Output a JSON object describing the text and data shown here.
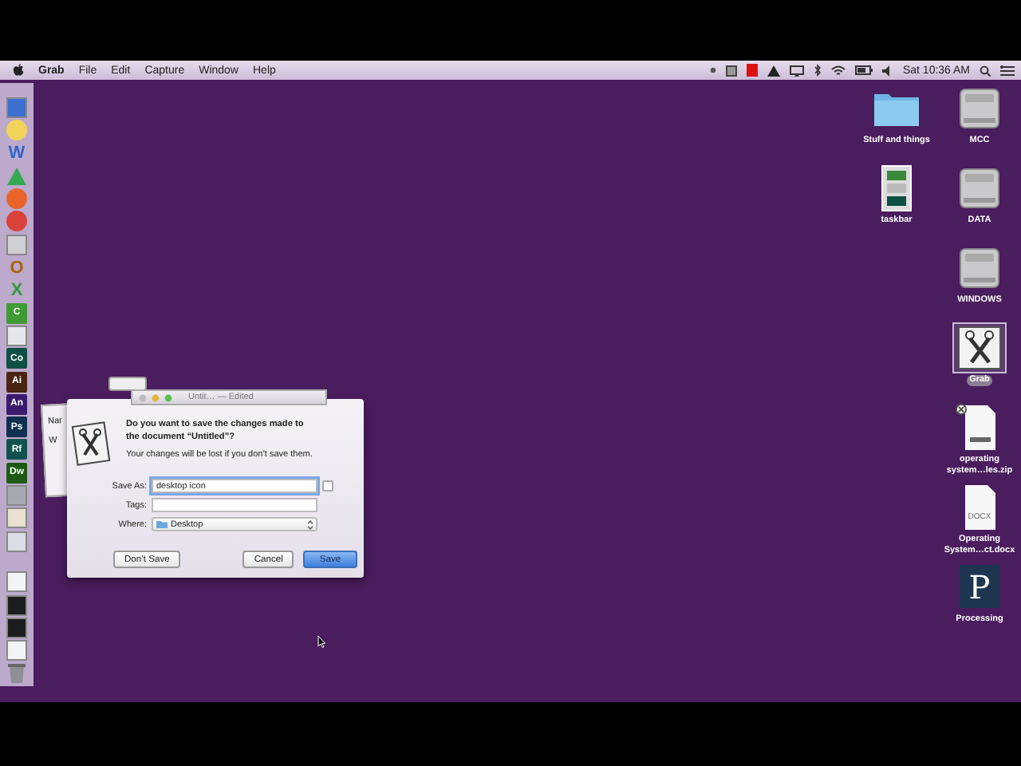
{
  "menubar": {
    "app": "Grab",
    "menus": [
      "File",
      "Edit",
      "Capture",
      "Window",
      "Help"
    ],
    "clock": "Sat 10:36 AM"
  },
  "dock": {
    "items": [
      {
        "kind": "tile",
        "color": "#3b6fd0"
      },
      {
        "kind": "round",
        "color": "#f2d35a"
      },
      {
        "kind": "letter",
        "label": "W",
        "color": "#2c66c9"
      },
      {
        "kind": "triangle",
        "color": "#36a852"
      },
      {
        "kind": "round",
        "color": "#e8642a"
      },
      {
        "kind": "round",
        "color": "#d9413a"
      },
      {
        "kind": "tile",
        "color": "#cfcfd4"
      },
      {
        "kind": "letter",
        "label": "O",
        "color": "#a8620a"
      },
      {
        "kind": "letter",
        "label": "X",
        "color": "#2f9a3a"
      },
      {
        "kind": "box",
        "label": "C",
        "color": "#3f9b34"
      },
      {
        "kind": "tile",
        "color": "#e6e6ea"
      },
      {
        "kind": "box",
        "label": "Co",
        "color": "#0e4f44"
      },
      {
        "kind": "box",
        "label": "Ai",
        "color": "#4a2511"
      },
      {
        "kind": "box",
        "label": "An",
        "color": "#3a1a6e"
      },
      {
        "kind": "box",
        "label": "Ps",
        "color": "#0f3050"
      },
      {
        "kind": "box",
        "label": "Rf",
        "color": "#10524d"
      },
      {
        "kind": "box",
        "label": "Dw",
        "color": "#1d5a12"
      },
      {
        "kind": "tile",
        "color": "#a8a8b0"
      },
      {
        "kind": "tile",
        "color": "#e9e2d0"
      },
      {
        "kind": "tile",
        "color": "#dcdce4"
      },
      {
        "kind": "gap"
      },
      {
        "kind": "tile",
        "color": "#f4f4f6"
      },
      {
        "kind": "tile",
        "color": "#1c1c1c"
      },
      {
        "kind": "tile",
        "color": "#1c1c1c"
      },
      {
        "kind": "tile",
        "color": "#f4f4f6"
      },
      {
        "kind": "trash",
        "color": "#8e8e96"
      }
    ]
  },
  "background_window": {
    "title": "Untit… — Edited",
    "texts": [
      "Nar",
      "W"
    ]
  },
  "save_sheet": {
    "heading": "Do you want to save the changes made to the document “Untitled”?",
    "message": "Your changes will be lost if you don’t save them.",
    "save_as": {
      "label": "Save As:",
      "value": "desktop icon"
    },
    "tags": {
      "label": "Tags:"
    },
    "where": {
      "label": "Where:",
      "value": "Desktop"
    },
    "buttons": [
      {
        "label": "Don’t Save",
        "default": false
      },
      {
        "label": "Cancel",
        "default": false
      },
      {
        "label": "Save",
        "default": true
      }
    ]
  },
  "desktop": {
    "columns": [
      [
        {
          "kind": "folder",
          "label": "Stuff and things",
          "selected": false
        },
        {
          "kind": "screenshot",
          "label": "taskbar",
          "selected": false
        }
      ],
      [
        {
          "kind": "drive",
          "label": "MCC",
          "selected": false
        },
        {
          "kind": "drive",
          "label": "DATA",
          "selected": false
        },
        {
          "kind": "drive",
          "label": "WINDOWS",
          "selected": false
        },
        {
          "kind": "grab",
          "label": "Grab",
          "selected": true
        },
        {
          "kind": "zip",
          "label": "operating system…les.zip",
          "selected": false
        },
        {
          "kind": "docx",
          "label": "Operating System…ct.docx",
          "badge": "DOCX",
          "selected": false
        },
        {
          "kind": "processing",
          "label": "Processing",
          "glyph": "P",
          "selected": false
        }
      ]
    ]
  }
}
